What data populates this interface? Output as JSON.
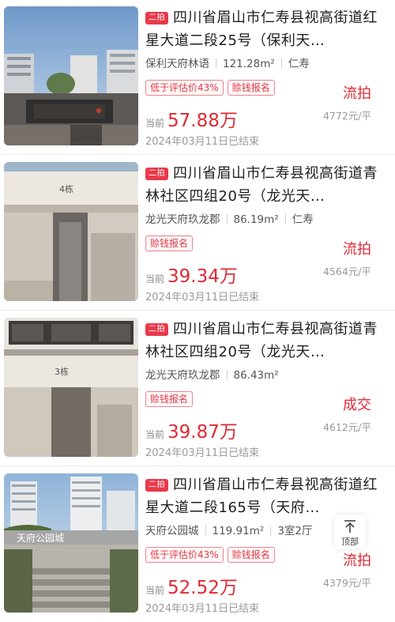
{
  "listings": [
    {
      "badge": "二拍",
      "title": "四川省眉山市仁寿县视高街道红星大道二段25号（保利天…",
      "community": "保利天府林语",
      "area": "121.28m²",
      "district": "仁寿",
      "tags": [
        "低于评估价43%",
        "赊钱报名"
      ],
      "status": "流拍",
      "price_label": "当前",
      "price": "57.88万",
      "unit_price": "4772元/平",
      "date": "2024年03月11日已结束"
    },
    {
      "badge": "二拍",
      "title": "四川省眉山市仁寿县视高街道青林社区四组20号（龙光天…",
      "community": "龙光天府玖龙郡",
      "area": "86.19m²",
      "district": "仁寿",
      "tags": [
        "赊钱报名"
      ],
      "status": "流拍",
      "price_label": "当前",
      "price": "39.34万",
      "unit_price": "4564元/平",
      "date": "2024年03月11日已结束"
    },
    {
      "badge": "二拍",
      "title": "四川省眉山市仁寿县视高街道青林社区四组20号（龙光天…",
      "community": "龙光天府玖龙郡",
      "area": "86.43m²",
      "district": "",
      "tags": [
        "赊钱报名"
      ],
      "status": "成交",
      "price_label": "当前",
      "price": "39.87万",
      "unit_price": "4612元/平",
      "date": "2024年03月11日已结束"
    },
    {
      "badge": "二拍",
      "title": "四川省眉山市仁寿县视高街道红星大道二段165号（天府…",
      "community": "天府公园城",
      "area": "119.91m²",
      "district": "3室2厅",
      "tags": [
        "低于评估价43%",
        "赊钱报名"
      ],
      "status": "流拍",
      "price_label": "当前",
      "price": "52.52万",
      "unit_price": "4379元/平",
      "date": "2024年03月11日已结束"
    }
  ],
  "thumb_labels": [
    "4栋",
    "3栋",
    "天府公园城"
  ],
  "back_to_top": "顶部",
  "colors": {
    "accent": "#e02a34",
    "badge": "#e9394a",
    "tag_border": "#e8868e"
  }
}
